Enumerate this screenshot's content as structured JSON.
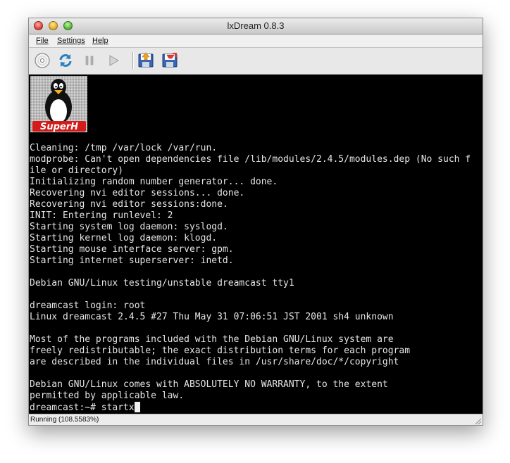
{
  "window": {
    "title": "lxDream 0.8.3"
  },
  "menu": {
    "items": [
      {
        "label": "File"
      },
      {
        "label": "Settings"
      },
      {
        "label": "Help"
      }
    ]
  },
  "toolbar": {
    "buttons": [
      {
        "icon": "disc-icon",
        "name": "mount-disc"
      },
      {
        "icon": "reset-icon",
        "name": "reset"
      },
      {
        "icon": "pause-icon",
        "name": "pause"
      },
      {
        "icon": "play-icon",
        "name": "run"
      },
      {
        "icon": "load-state-icon",
        "name": "load-state"
      },
      {
        "icon": "save-state-icon",
        "name": "save-state"
      }
    ]
  },
  "logo": {
    "text": "SuperH"
  },
  "console": {
    "lines": [
      "Cleaning: /tmp /var/lock /var/run.",
      "modprobe: Can't open dependencies file /lib/modules/2.4.5/modules.dep (No such f",
      "ile or directory)",
      "Initializing random number generator... done.",
      "Recovering nvi editor sessions... done.",
      "Recovering nvi editor sessions:done.",
      "INIT: Entering runlevel: 2",
      "Starting system log daemon: syslogd.",
      "Starting kernel log daemon: klogd.",
      "Starting mouse interface server: gpm.",
      "Starting internet superserver: inetd.",
      "",
      "Debian GNU/Linux testing/unstable dreamcast tty1",
      "",
      "dreamcast login: root",
      "Linux dreamcast 2.4.5 #27 Thu May 31 07:06:51 JST 2001 sh4 unknown",
      "",
      "Most of the programs included with the Debian GNU/Linux system are",
      "freely redistributable; the exact distribution terms for each program",
      "are described in the individual files in /usr/share/doc/*/copyright",
      "",
      "Debian GNU/Linux comes with ABSOLUTELY NO WARRANTY, to the extent",
      "permitted by applicable law."
    ],
    "prompt": "dreamcast:~# startx"
  },
  "status": {
    "text": "Running (108.5583%)"
  }
}
